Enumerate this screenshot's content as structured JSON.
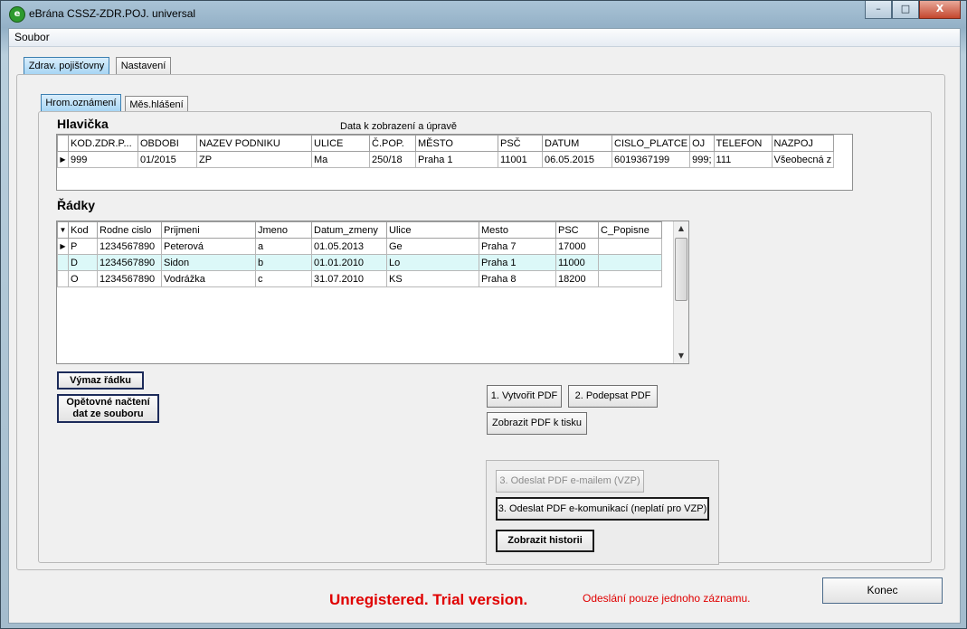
{
  "window": {
    "title": "eBrána CSSZ-ZDR.POJ. universal",
    "min": "–",
    "max": "□",
    "close": "X"
  },
  "menu": {
    "soubor": "Soubor"
  },
  "tabs_top": [
    {
      "label": "Zdrav. pojišťovny",
      "active": true
    },
    {
      "label": "Nastavení",
      "active": false
    }
  ],
  "tabs_inner": [
    {
      "label": "Hrom.oznámení",
      "active": true
    },
    {
      "label": "Měs.hlášení",
      "active": false
    }
  ],
  "hlavicka": {
    "title": "Hlavička",
    "caption": "Data k zobrazení a úpravě",
    "columns": [
      "KOD.ZDR.P...",
      "OBDOBI",
      "NAZEV PODNIKU",
      "ULICE",
      "Č.POP.",
      "MĚSTO",
      "PSČ",
      "DATUM",
      "CISLO_PLATCE",
      "OJ",
      "TELEFON",
      "NAZPOJ"
    ],
    "rows": [
      [
        "999",
        "01/2015",
        "ZP",
        "Ma",
        "250/18",
        "Praha 1",
        "11001",
        "06.05.2015",
        "6019367199",
        "999;",
        "111",
        "Všeobecná z"
      ]
    ]
  },
  "radky": {
    "title": "Řádky",
    "columns": [
      "Kod",
      "Rodne cislo",
      "Prijmeni",
      "Jmeno",
      "Datum_zmeny",
      "Ulice",
      "Mesto",
      "PSC",
      "C_Popisne"
    ],
    "rows": [
      [
        "P",
        "1234567890",
        "Peterová",
        "a",
        "01.05.2013",
        "Ge",
        "Praha 7",
        "17000",
        ""
      ],
      [
        "D",
        "1234567890",
        "Sidon",
        "b",
        "01.01.2010",
        "Lo",
        "Praha 1",
        "11000",
        ""
      ],
      [
        "O",
        "1234567890",
        "Vodrážka",
        "c",
        "31.07.2010",
        "KS",
        "Praha 8",
        "18200",
        ""
      ]
    ],
    "selected_row": 0,
    "highlighted_row": 1
  },
  "buttons": {
    "vymaz": "Výmaz řádku",
    "opetovne_line1": "Opětovné načtení",
    "opetovne_line2": "dat ze souboru",
    "vytvorit": "1. Vytvořit PDF",
    "podepsat": "2. Podepsat PDF",
    "zobrazit_pdf": "Zobrazit PDF k tisku",
    "odeslat_email": "3. Odeslat PDF e-mailem (VZP)",
    "odeslat_ekom": "3. Odeslat PDF e-komunikací (neplatí pro VZP)",
    "historie": "Zobrazit historii",
    "konec": "Konec"
  },
  "footer": {
    "trial": "Unregistered. Trial version.",
    "note": "Odeslání pouze jednoho záznamu."
  },
  "colors": {
    "trial": "#e00000",
    "highlight_row": "#dcf8f8",
    "active_tab": "#a7d5f4"
  }
}
